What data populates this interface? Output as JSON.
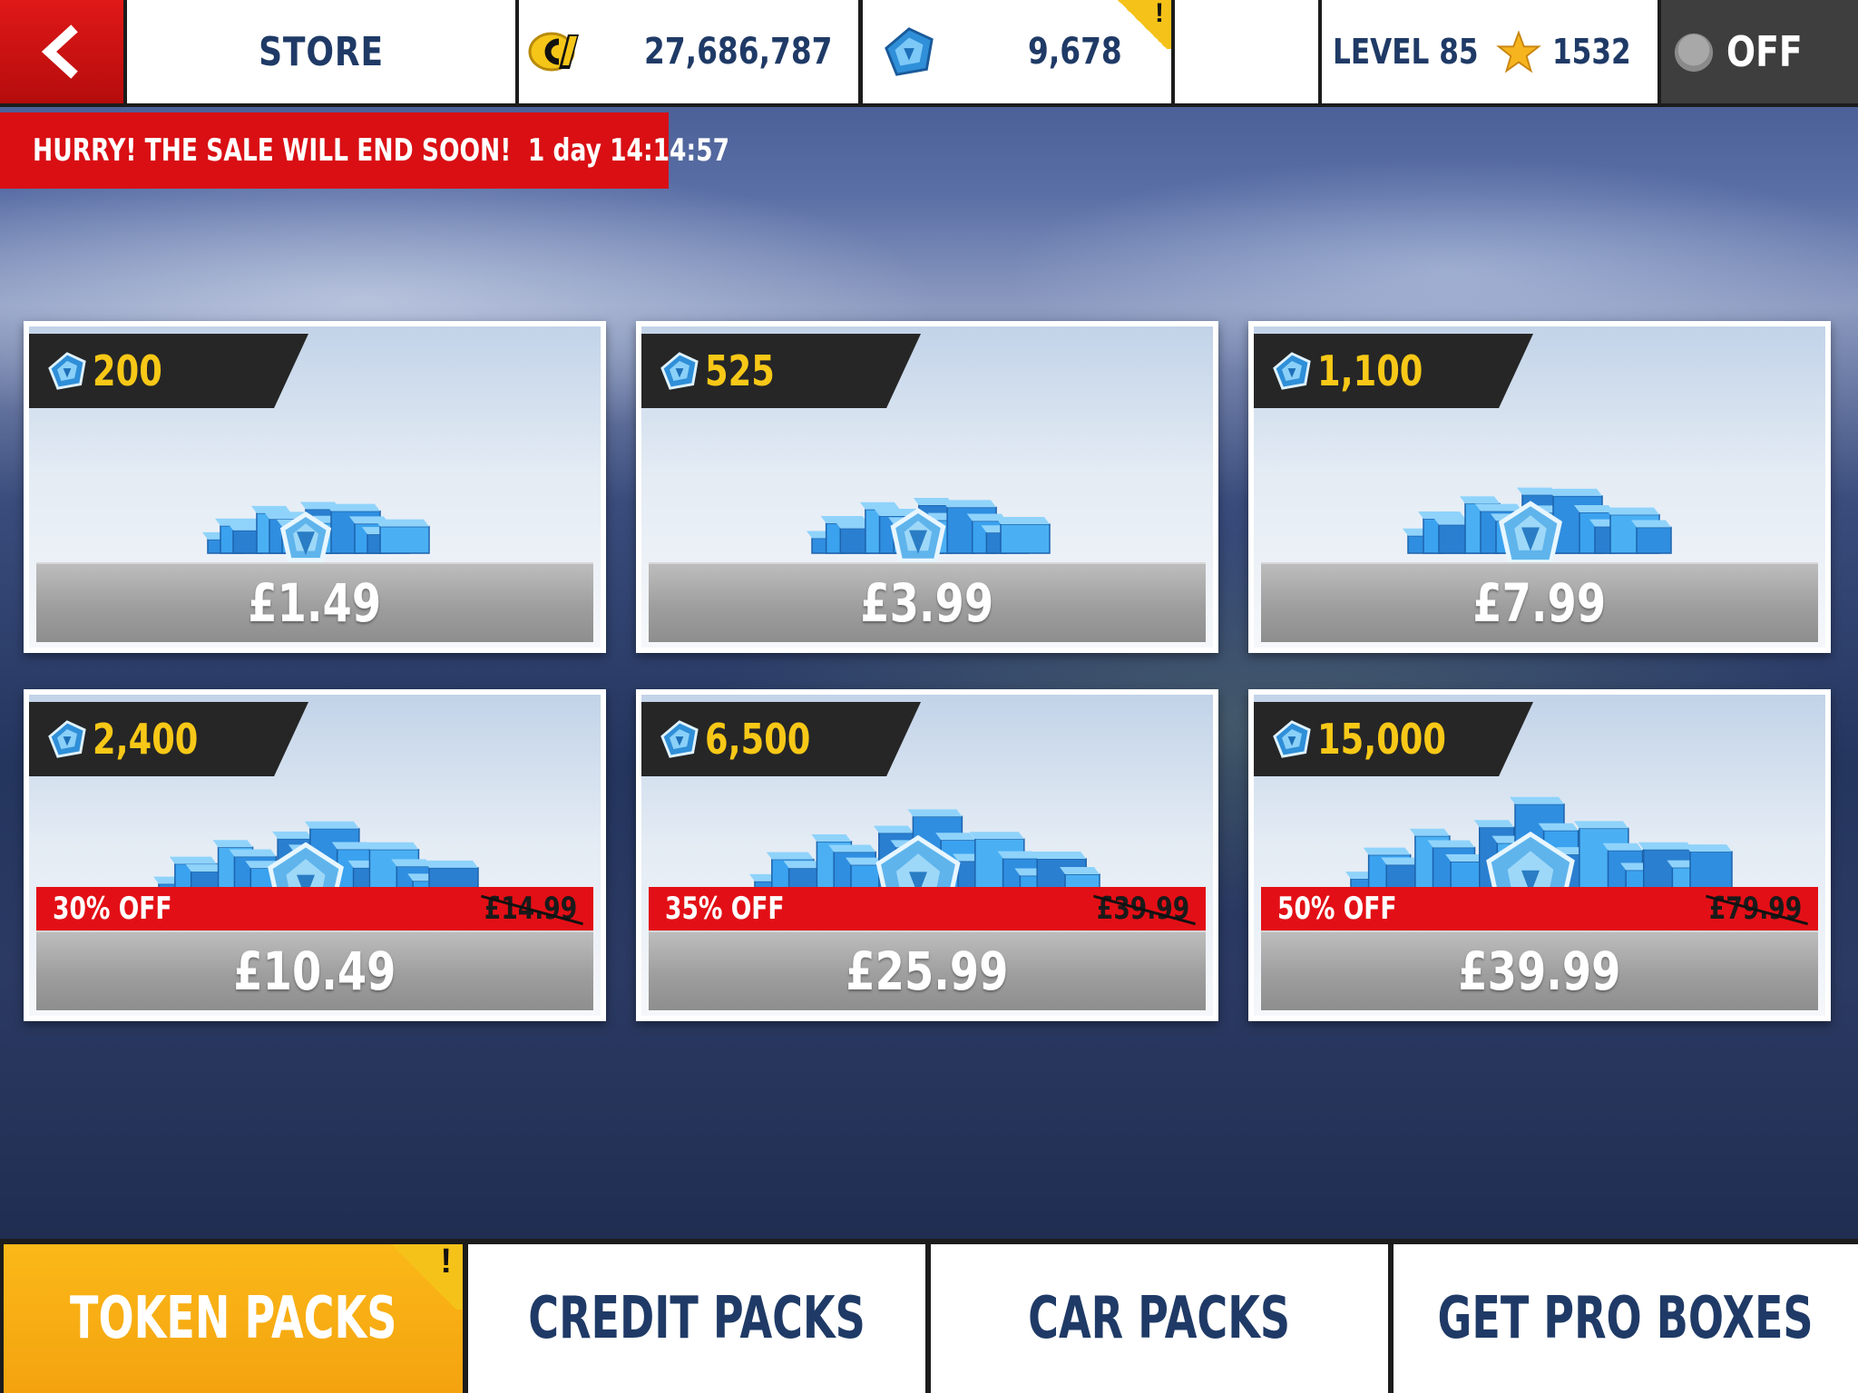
{
  "header": {
    "title": "STORE",
    "credits": "27,686,787",
    "tokens": "9,678",
    "tokens_alert": "!",
    "level": "LEVEL 85",
    "stars": "1532",
    "toggle": "OFF"
  },
  "sale_banner": {
    "message": "HURRY! THE SALE WILL END SOON!",
    "countdown": "1 day 14:14:57"
  },
  "packs": [
    {
      "amount": "200",
      "price": "£1.49",
      "discount": "",
      "old_price": ""
    },
    {
      "amount": "525",
      "price": "£3.99",
      "discount": "",
      "old_price": ""
    },
    {
      "amount": "1,100",
      "price": "£7.99",
      "discount": "",
      "old_price": ""
    },
    {
      "amount": "2,400",
      "price": "£10.49",
      "discount": "30% OFF",
      "old_price": "£14.99"
    },
    {
      "amount": "6,500",
      "price": "£25.99",
      "discount": "35% OFF",
      "old_price": "£39.99"
    },
    {
      "amount": "15,000",
      "price": "£39.99",
      "discount": "50% OFF",
      "old_price": "£79.99"
    }
  ],
  "tabs": [
    {
      "label": "TOKEN PACKS",
      "active": true,
      "alert": "!"
    },
    {
      "label": "CREDIT PACKS",
      "active": false
    },
    {
      "label": "CAR PACKS",
      "active": false
    },
    {
      "label": "GET PRO BOXES",
      "active": false
    }
  ],
  "icons": {
    "back": "chevron-left-icon",
    "credits": "credit-coin-icon",
    "tokens": "token-gem-icon",
    "star": "star-icon",
    "toggle": "toggle-off-icon"
  },
  "colors": {
    "accent_red": "#d90f14",
    "accent_yellow": "#f7c817",
    "tab_active": "#f4a30f",
    "text_navy": "#1f3a66"
  }
}
